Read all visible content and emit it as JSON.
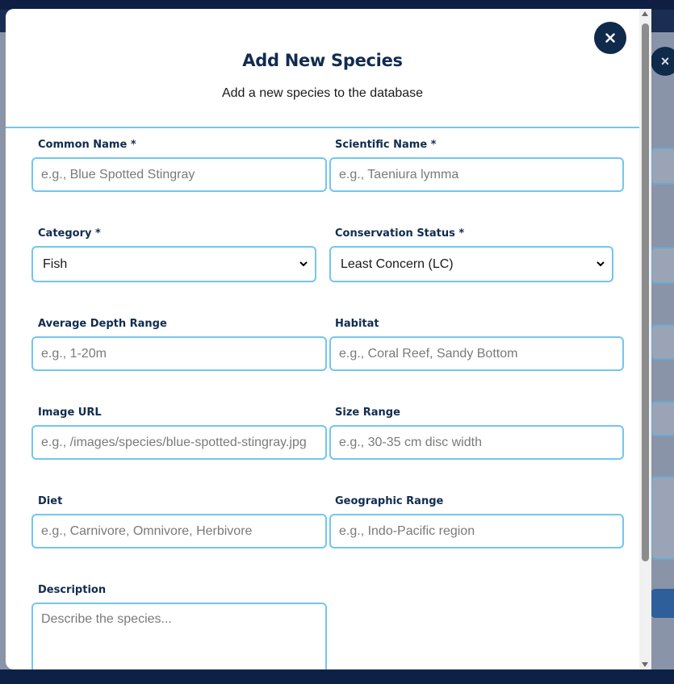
{
  "modal": {
    "title": "Add New Species",
    "subtitle": "Add a new species to the database",
    "close_icon": "close-icon"
  },
  "form": {
    "common_name": {
      "label": "Common Name *",
      "placeholder": "e.g., Blue Spotted Stingray",
      "value": ""
    },
    "scientific_name": {
      "label": "Scientific Name *",
      "placeholder": "e.g., Taeniura lymma",
      "value": ""
    },
    "category": {
      "label": "Category *",
      "value": "Fish"
    },
    "conservation_status": {
      "label": "Conservation Status *",
      "value": "Least Concern (LC)"
    },
    "depth_range": {
      "label": "Average Depth Range",
      "placeholder": "e.g., 1-20m",
      "value": ""
    },
    "habitat": {
      "label": "Habitat",
      "placeholder": "e.g., Coral Reef, Sandy Bottom",
      "value": ""
    },
    "image_url": {
      "label": "Image URL",
      "placeholder": "e.g., /images/species/blue-spotted-stingray.jpg",
      "value": ""
    },
    "size_range": {
      "label": "Size Range",
      "placeholder": "e.g., 30-35 cm disc width",
      "value": ""
    },
    "diet": {
      "label": "Diet",
      "placeholder": "e.g., Carnivore, Omnivore, Herbivore",
      "value": ""
    },
    "geographic_range": {
      "label": "Geographic Range",
      "placeholder": "e.g., Indo-Pacific region",
      "value": ""
    },
    "description": {
      "label": "Description",
      "placeholder": "Describe the species...",
      "value": ""
    }
  },
  "background_close_icon": "close-icon",
  "colors": {
    "accent_border": "#72c6ef",
    "title_navy": "#102c4f",
    "overlay_navy": "#0d2147"
  }
}
